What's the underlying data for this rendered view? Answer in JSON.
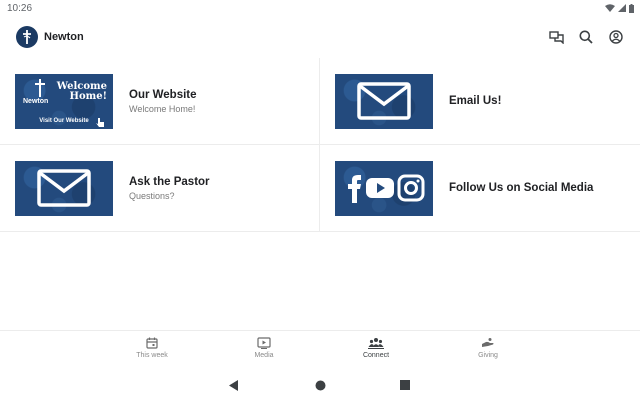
{
  "status": {
    "time": "10:26"
  },
  "appbar": {
    "title": "Newton",
    "icons": [
      "chat-icon",
      "search-icon",
      "account-icon"
    ]
  },
  "cards": [
    {
      "title": "Our Website",
      "subtitle": "Welcome Home!",
      "thumb": "welcome",
      "thumb_text": {
        "welcome": "Welcome Home!",
        "brand": "Newton",
        "visit": "Visit Our Website"
      }
    },
    {
      "title": "Email Us!",
      "subtitle": "",
      "thumb": "envelope"
    },
    {
      "title": "Ask the Pastor",
      "subtitle": "Questions?",
      "thumb": "envelope"
    },
    {
      "title": "Follow Us on Social Media",
      "subtitle": "",
      "thumb": "social"
    }
  ],
  "bottomnav": {
    "items": [
      {
        "label": "This week",
        "icon": "calendar-icon"
      },
      {
        "label": "Media",
        "icon": "play-icon"
      },
      {
        "label": "Connect",
        "icon": "group-icon",
        "active": true
      },
      {
        "label": "Giving",
        "icon": "giving-hand-icon"
      }
    ]
  },
  "colors": {
    "brand": "#1b3a63",
    "thumb_bg": "#234a7d",
    "text": "#202124",
    "muted": "#7a7a7a"
  }
}
